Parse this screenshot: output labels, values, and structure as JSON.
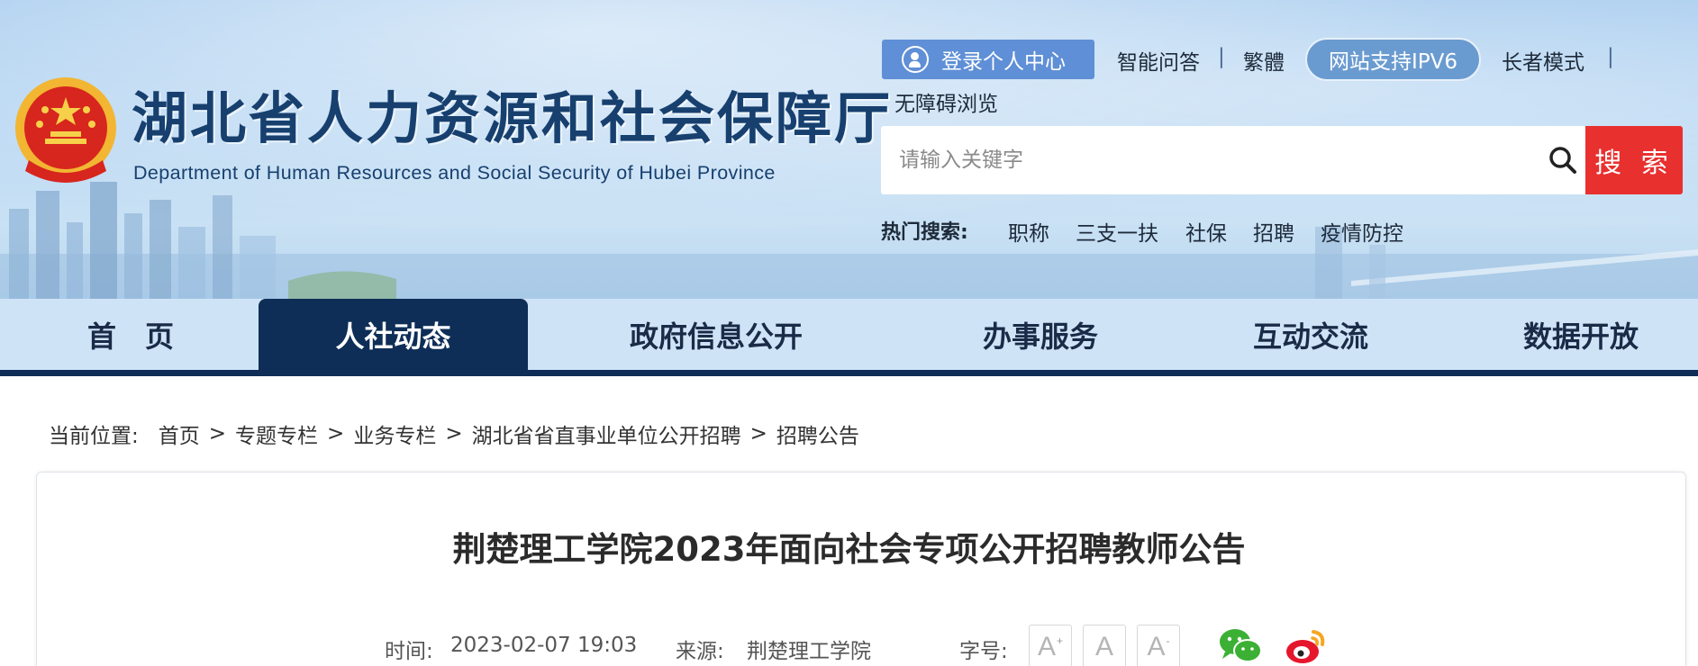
{
  "site": {
    "title": "湖北省人力资源和社会保障厅",
    "subtitle": "Department of Human Resources and Social Security of Hubei Province",
    "emblem_icon": "national-emblem-icon"
  },
  "toplinks": {
    "login": "登录个人中心",
    "qa": "智能问答",
    "traditional": "繁體",
    "ipv6": "网站支持IPV6",
    "elder_mode": "长者模式",
    "accessible": "无障碍浏览",
    "separator": "|"
  },
  "search": {
    "placeholder": "请输入关键字",
    "button": "搜 索",
    "hot_label": "热门搜索:",
    "hot_items": [
      "职称",
      "三支一扶",
      "社保",
      "招聘",
      "疫情防控"
    ]
  },
  "nav": {
    "items": [
      "首　页",
      "人社动态",
      "政府信息公开",
      "办事服务",
      "互动交流",
      "数据开放"
    ],
    "active": "人社动态"
  },
  "breadcrumb": {
    "prefix": "当前位置:",
    "items": [
      "首页",
      "专题专栏",
      "业务专栏",
      "湖北省省直事业单位公开招聘",
      "招聘公告"
    ],
    "separator": ">"
  },
  "article": {
    "title": "荆楚理工学院2023年面向社会专项公开招聘教师公告",
    "time_label": "时间:",
    "time": "2023-02-07 19:03",
    "source_label": "来源:",
    "source": "荆楚理工学院",
    "fontsize_label": "字号:",
    "font_buttons": [
      "A",
      "A",
      "A"
    ],
    "font_button_marks": [
      "+",
      "",
      "-"
    ],
    "share_icons": [
      "wechat-icon",
      "weibo-icon"
    ]
  },
  "colors": {
    "navy": "#0e2e57",
    "search_red": "#e8302f",
    "login_blue": "#5f8fd6",
    "title_blue": "#17406f"
  }
}
